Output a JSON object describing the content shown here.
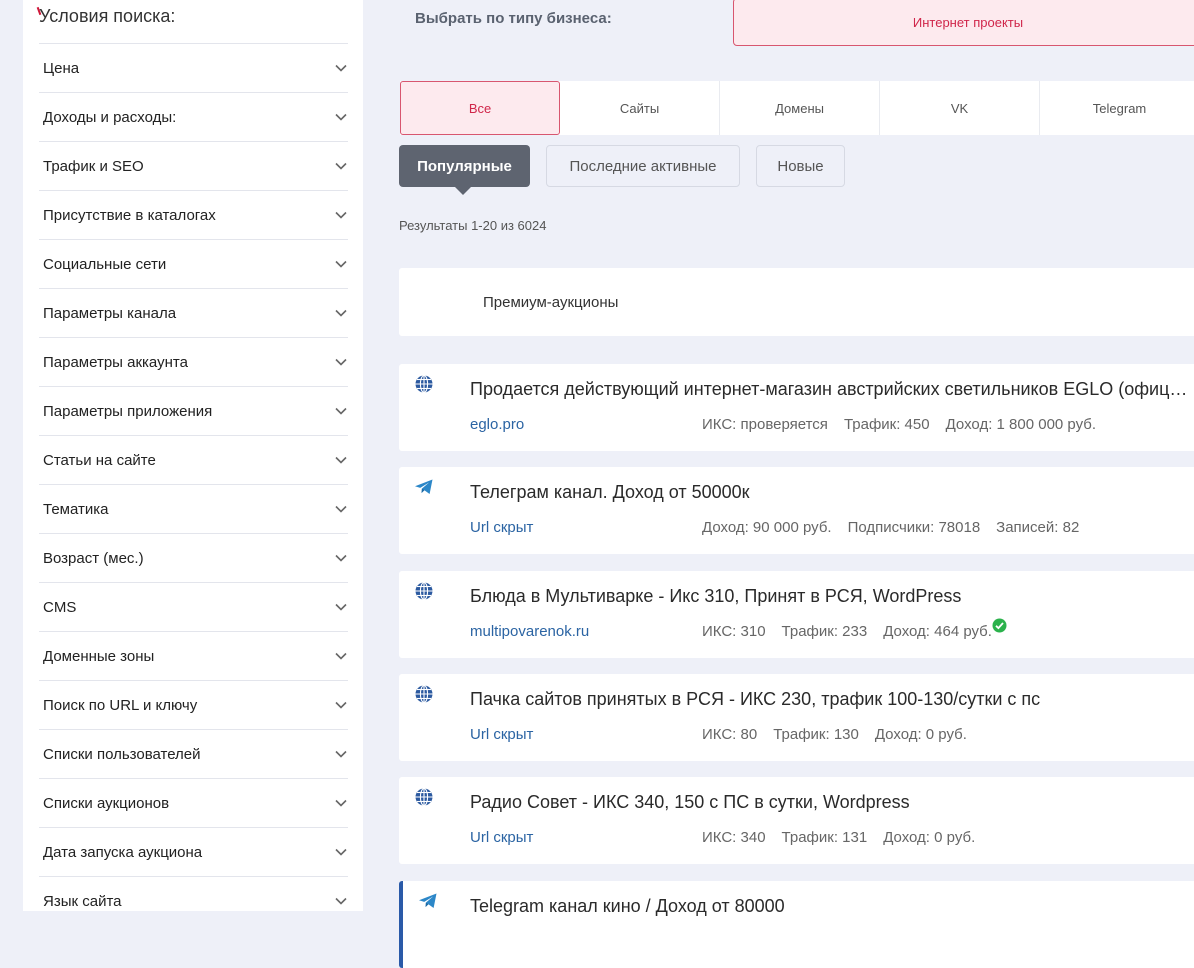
{
  "sidebar": {
    "title": "Условия поиска:",
    "filters": [
      "Цена",
      "Доходы и расходы:",
      "Трафик и SEO",
      "Присутствие в каталогах",
      "Социальные сети",
      "Параметры канала",
      "Параметры аккаунта",
      "Параметры приложения",
      "Статьи на сайте",
      "Тематика",
      "Возраст (мес.)",
      "CMS",
      "Доменные зоны",
      "Поиск по URL и ключу",
      "Списки пользователей",
      "Списки аукционов",
      "Дата запуска аукциона",
      "Язык сайта"
    ]
  },
  "business_type": {
    "label": "Выбрать по типу бизнеса:",
    "selected": "Интернет проекты"
  },
  "type_tabs": [
    "Все",
    "Сайты",
    "Домены",
    "VK",
    "Telegram"
  ],
  "sort": {
    "popular": "Популярные",
    "recent": "Последние активные",
    "new": "Новые"
  },
  "results_count": "Результаты 1-20 из 6024",
  "premium_label": "Премиум-аукционы",
  "colors": {
    "accent": "#d0264a",
    "accent_bg": "#fdeaee",
    "link": "#2b64a3",
    "dark_button": "#5e6470",
    "page_bg": "#eef0f8"
  },
  "listings": [
    {
      "icon": "globe-icon",
      "title": "Продается действующий интернет-магазин австрийских светильников EGLO (официальный дилер)",
      "url": "eglo.pro",
      "meta": [
        "ИКС: проверяется",
        "Трафик: 450",
        "Доход: 1 800 000 руб."
      ]
    },
    {
      "icon": "telegram-icon",
      "title": "Телеграм канал. Доход от 50000к",
      "url": "Url скрыт",
      "meta": [
        "Доход: 90 000 руб.",
        "Подписчики: 78018",
        "Записей: 82"
      ]
    },
    {
      "icon": "globe-icon",
      "title": "Блюда в Мультиварке - Икс 310, Принят в РСЯ, WordPress",
      "url": "multipovarenok.ru",
      "meta": [
        "ИКС: 310",
        "Трафик: 233",
        "Доход: 464 руб."
      ],
      "verified": true
    },
    {
      "icon": "globe-icon",
      "title": "Пачка сайтов принятых в РСЯ - ИКС 230, трафик 100-130/сутки с пс",
      "url": "Url скрыт",
      "meta": [
        "ИКС: 80",
        "Трафик: 130",
        "Доход: 0 руб."
      ]
    },
    {
      "icon": "globe-icon",
      "title": "Радио Совет - ИКС 340, 150 с ПС в сутки, Wordpress",
      "url": "Url скрыт",
      "meta": [
        "ИКС: 340",
        "Трафик: 131",
        "Доход: 0 руб."
      ]
    },
    {
      "icon": "telegram-icon",
      "title": "Telegram канал кино / Доход от 80000"
    }
  ]
}
